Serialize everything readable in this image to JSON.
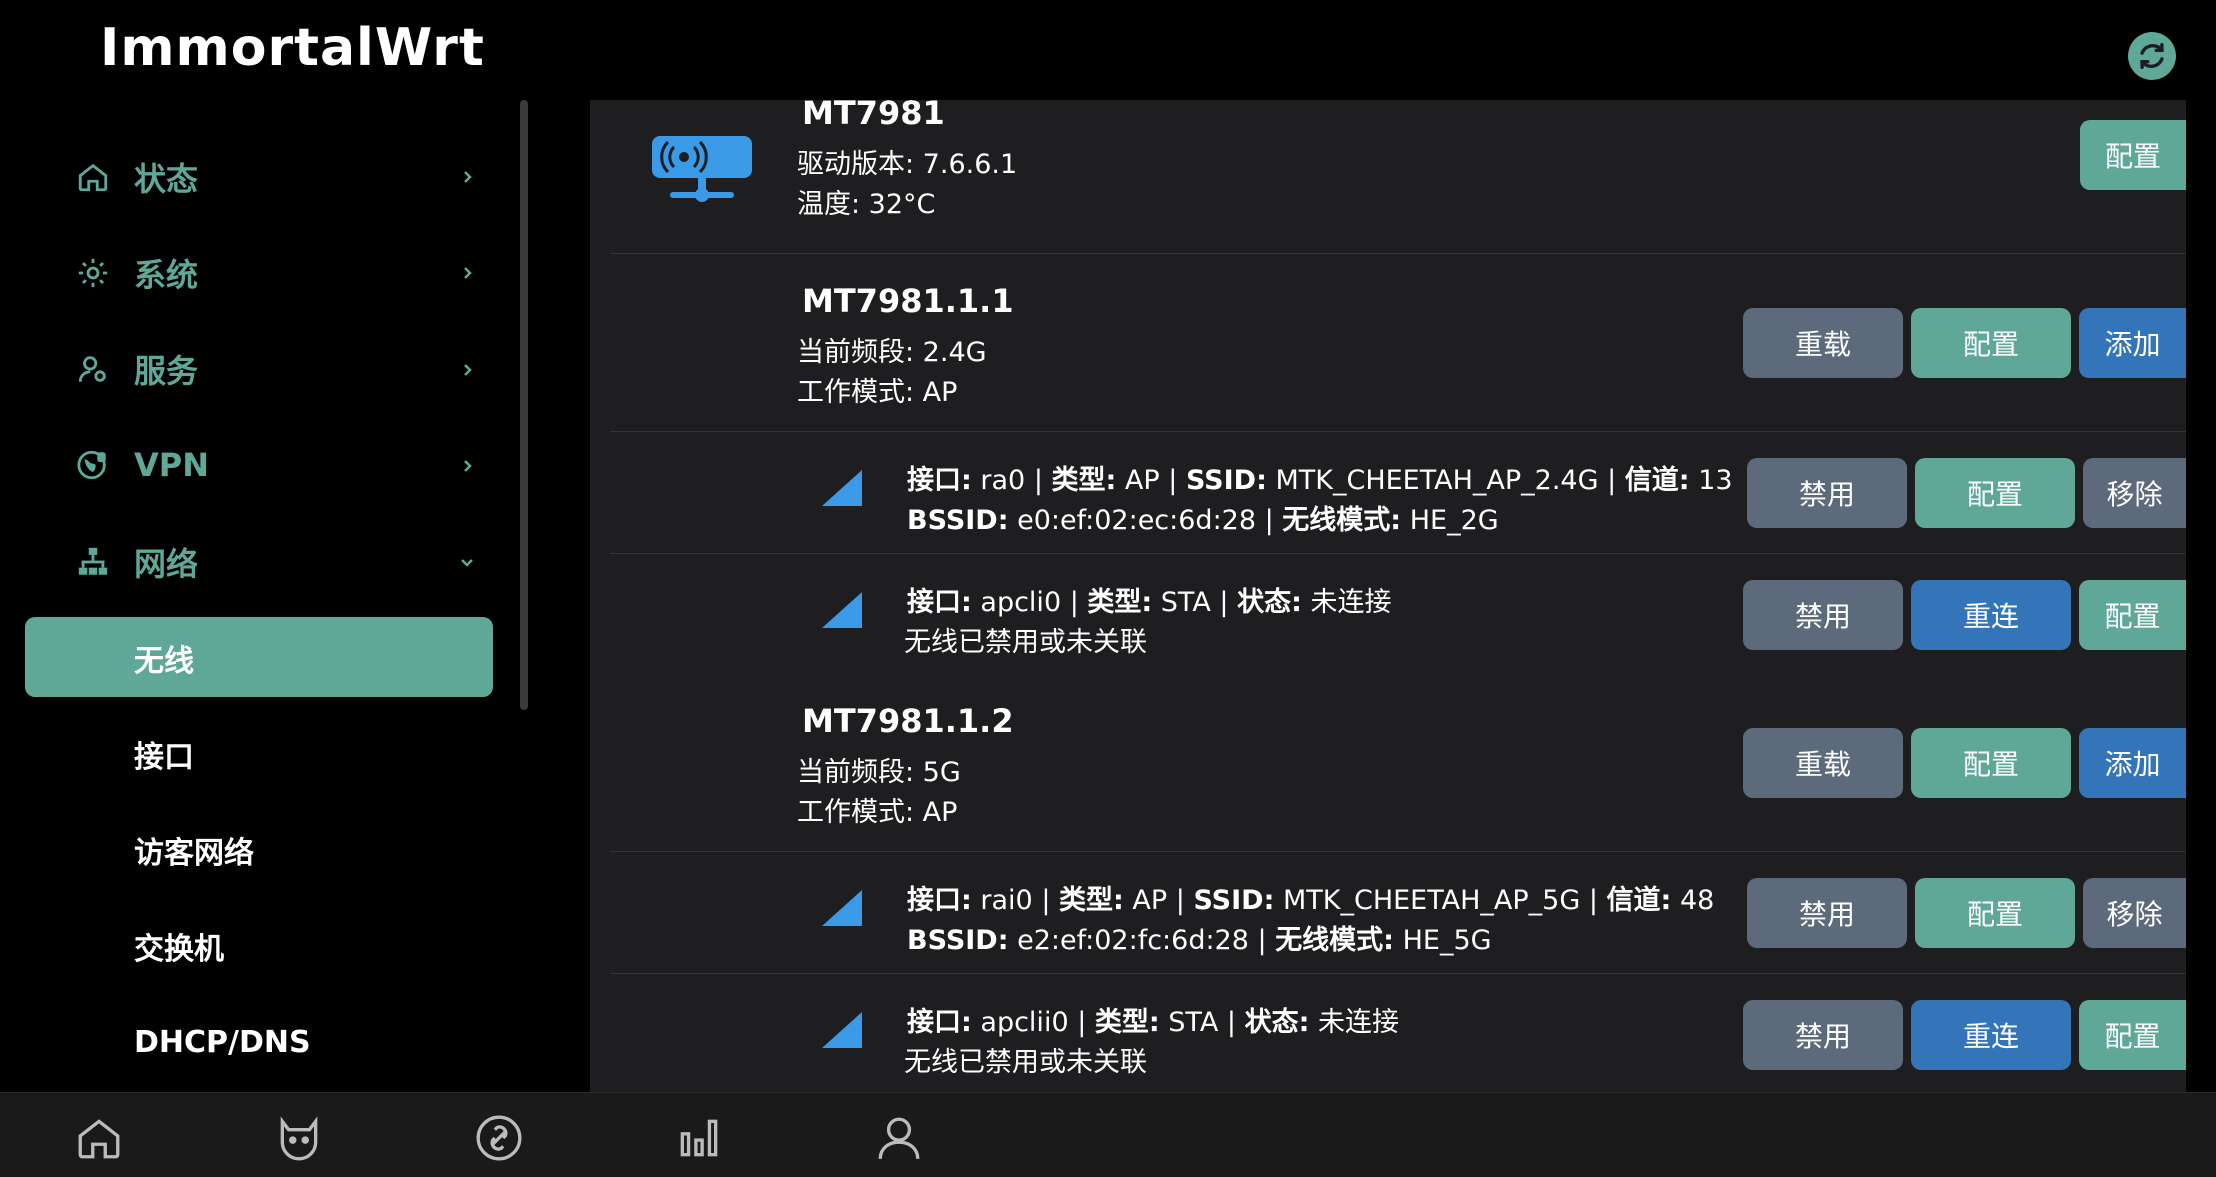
{
  "app": {
    "brand": "ImmortalWrt"
  },
  "sidebar": {
    "items": [
      {
        "label": "状态",
        "icon": "home-icon"
      },
      {
        "label": "系统",
        "icon": "gear-icon"
      },
      {
        "label": "服务",
        "icon": "user-gear-icon"
      },
      {
        "label": "VPN",
        "icon": "globe-shield-icon"
      },
      {
        "label": "网络",
        "icon": "network-icon"
      }
    ],
    "network_sub": [
      "无线",
      "接口",
      "访客网络",
      "交换机",
      "DHCP/DNS"
    ]
  },
  "device": {
    "name": "MT7981",
    "driver": "驱动版本: 7.6.6.1",
    "temp": "温度: 32°C",
    "config_btn": "配置"
  },
  "radios": [
    {
      "name": "MT7981.1.1",
      "band": "当前频段: 2.4G",
      "mode": "工作模式: AP",
      "buttons": [
        "重载",
        "配置",
        "添加"
      ],
      "ifaces": [
        {
          "k_iface": "接口:",
          "v_iface": "ra0",
          "k_type": "类型:",
          "v_type": "AP",
          "k_ssid": "SSID:",
          "v_ssid": "MTK_CHEETAH_AP_2.4G",
          "k_chan": "信道:",
          "v_chan": "13",
          "k_bssid": "BSSID:",
          "v_bssid": "e0:ef:02:ec:6d:28",
          "k_wmode": "无线模式:",
          "v_wmode": "HE_2G",
          "buttons": [
            "禁用",
            "配置",
            "移除"
          ]
        },
        {
          "k_iface": "接口:",
          "v_iface": "apcli0",
          "k_type": "类型:",
          "v_type": "STA",
          "k_state": "状态:",
          "v_state": "未连接",
          "note": "无线已禁用或未关联",
          "buttons": [
            "禁用",
            "重连",
            "配置"
          ]
        }
      ]
    },
    {
      "name": "MT7981.1.2",
      "band": "当前频段: 5G",
      "mode": "工作模式: AP",
      "buttons": [
        "重载",
        "配置",
        "添加"
      ],
      "ifaces": [
        {
          "k_iface": "接口:",
          "v_iface": "rai0",
          "k_type": "类型:",
          "v_type": "AP",
          "k_ssid": "SSID:",
          "v_ssid": "MTK_CHEETAH_AP_5G",
          "k_chan": "信道:",
          "v_chan": "48",
          "k_bssid": "BSSID:",
          "v_bssid": "e2:ef:02:fc:6d:28",
          "k_wmode": "无线模式:",
          "v_wmode": "HE_5G",
          "buttons": [
            "禁用",
            "配置",
            "移除"
          ]
        },
        {
          "k_iface": "接口:",
          "v_iface": "apclii0",
          "k_type": "类型:",
          "v_type": "STA",
          "k_state": "状态:",
          "v_state": "未连接",
          "note": "无线已禁用或未关联",
          "buttons": [
            "禁用",
            "重连",
            "配置"
          ]
        }
      ]
    }
  ],
  "sep": " | ",
  "colors": {
    "accent": "#5fa898",
    "blue": "#3474b8",
    "gray": "#5d6a7c",
    "bg": "#1e1e21"
  },
  "bottom_bar": [
    "home-icon",
    "cat-icon",
    "link-icon",
    "chart-icon",
    "user-icon"
  ]
}
